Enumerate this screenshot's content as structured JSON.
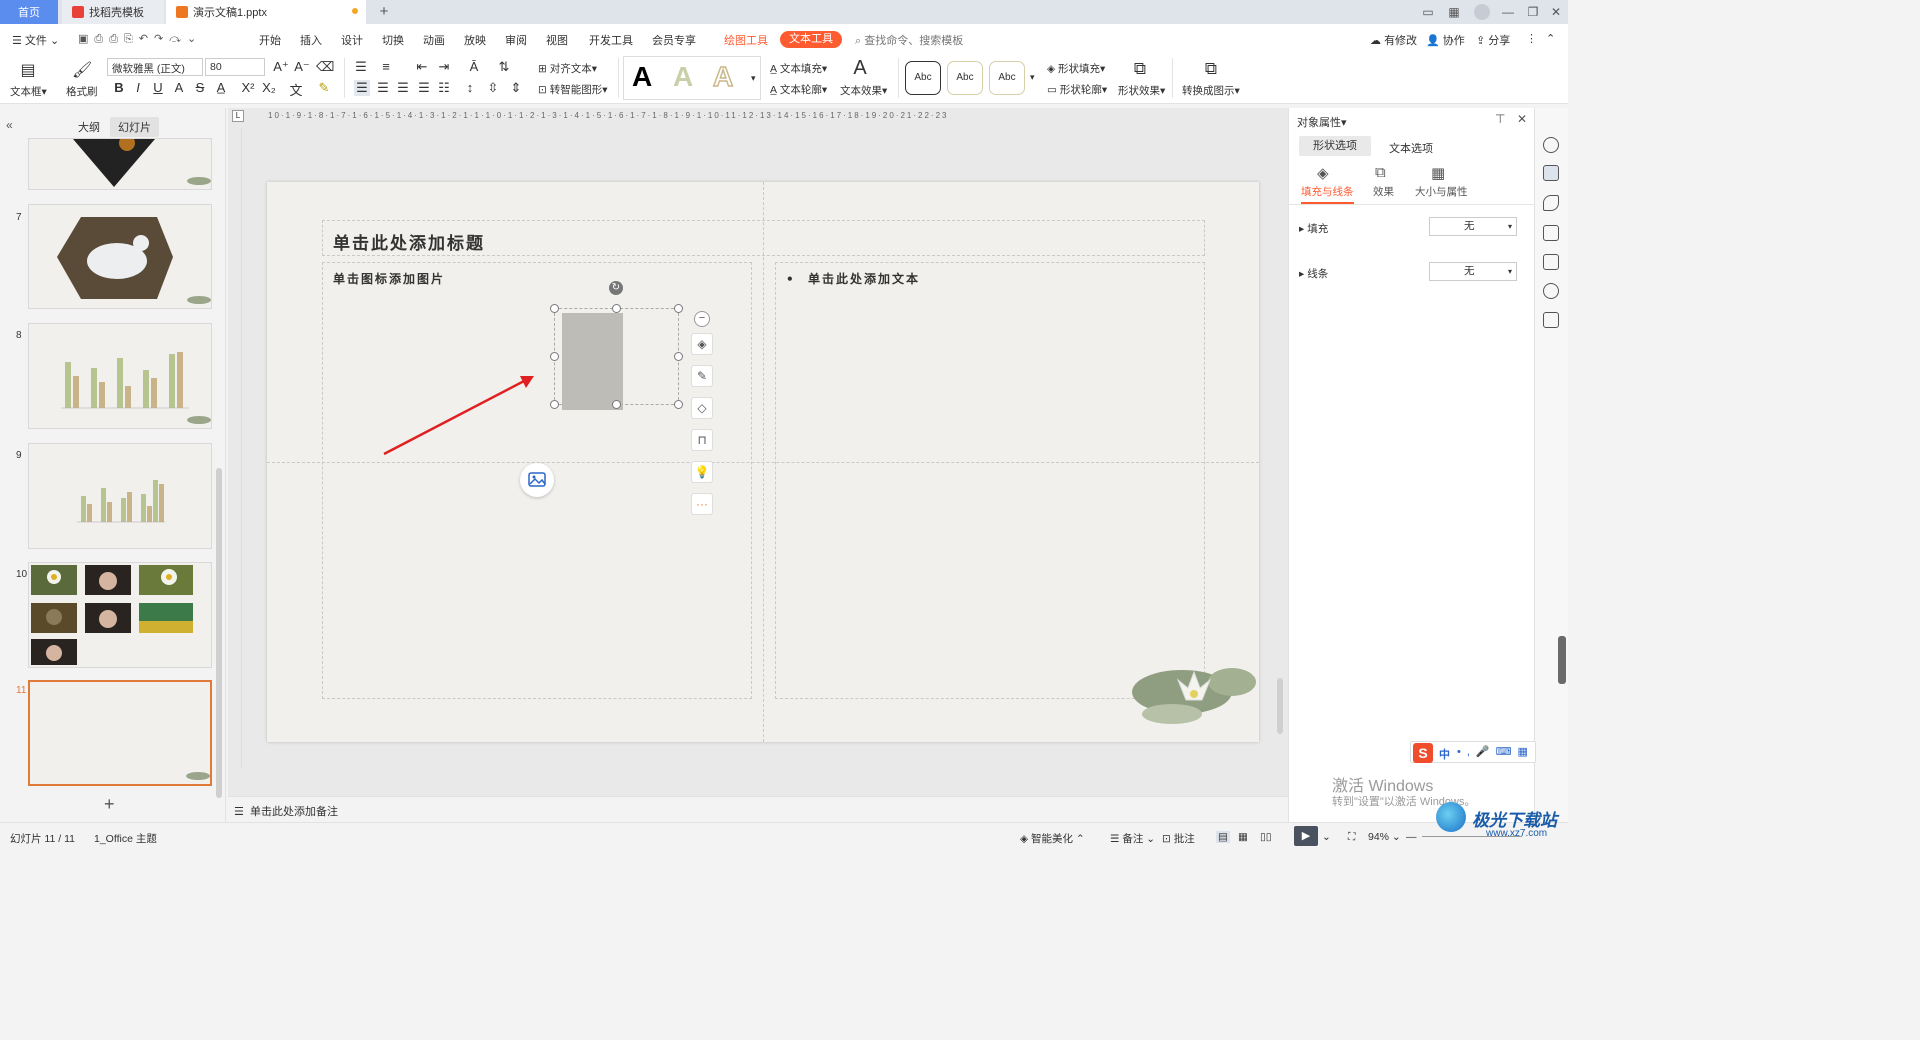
{
  "titlebar": {
    "tabs": [
      {
        "label": "首页"
      },
      {
        "label": "找稻壳模板"
      },
      {
        "label": "演示文稿1.pptx"
      }
    ],
    "new_tab": "+"
  },
  "menubar": {
    "file": "文件",
    "items": [
      "开始",
      "插入",
      "设计",
      "切换",
      "动画",
      "放映",
      "审阅",
      "视图",
      "开发工具",
      "会员专享",
      "绘图工具",
      "文本工具"
    ],
    "search_placeholder": "查找命令、搜索模板",
    "right": [
      "有修改",
      "协作",
      "分享"
    ]
  },
  "ribbon": {
    "textbox": "文本框",
    "format_painter": "格式刷",
    "font_name": "微软雅黑 (正文)",
    "font_size": "80",
    "align_text": "对齐文本",
    "smart_shape": "转智能图形",
    "text_fill": "文本填充",
    "text_outline": "文本轮廓",
    "text_effect": "文本效果",
    "abc_styles": [
      "Abc",
      "Abc",
      "Abc"
    ],
    "shape_fill": "形状填充",
    "shape_outline": "形状轮廓",
    "shape_effect": "形状效果",
    "convert": "转换成图示",
    "wordart_letters": [
      "A",
      "A",
      "A"
    ]
  },
  "leftpanel": {
    "tabs": [
      "大纲",
      "幻灯片"
    ],
    "slide_numbers": [
      "7",
      "8",
      "9",
      "10",
      "11"
    ],
    "add": "+"
  },
  "slide": {
    "title_placeholder": "单击此处添加标题",
    "left_placeholder": "单击图标添加图片",
    "right_placeholder": "单击此处添加文本"
  },
  "notes": {
    "placeholder": "单击此处添加备注"
  },
  "rightpanel": {
    "header": "对象属性",
    "tabs": [
      "形状选项",
      "文本选项"
    ],
    "subtabs": [
      "填充与线条",
      "效果",
      "大小与属性"
    ],
    "fill_label": "填充",
    "fill_value": "无",
    "line_label": "线条",
    "line_value": "无"
  },
  "status": {
    "slide_counter": "幻灯片 11 / 11",
    "theme": "1_Office 主题",
    "smart_beautify": "智能美化",
    "notes": "备注",
    "comments": "批注",
    "zoom": "94%"
  },
  "watermark": {
    "line1": "激活 Windows",
    "line2": "转到\"设置\"以激活 Windows。"
  },
  "ime": {
    "label": "中"
  },
  "logo": {
    "text": "极光下载站",
    "url_text": "www.xz7.com"
  },
  "colors": {
    "accent": "#ff5b30",
    "home_tab": "#5b8def",
    "selected_thumb_border": "#e07a3b",
    "arrow": "#e02020"
  }
}
